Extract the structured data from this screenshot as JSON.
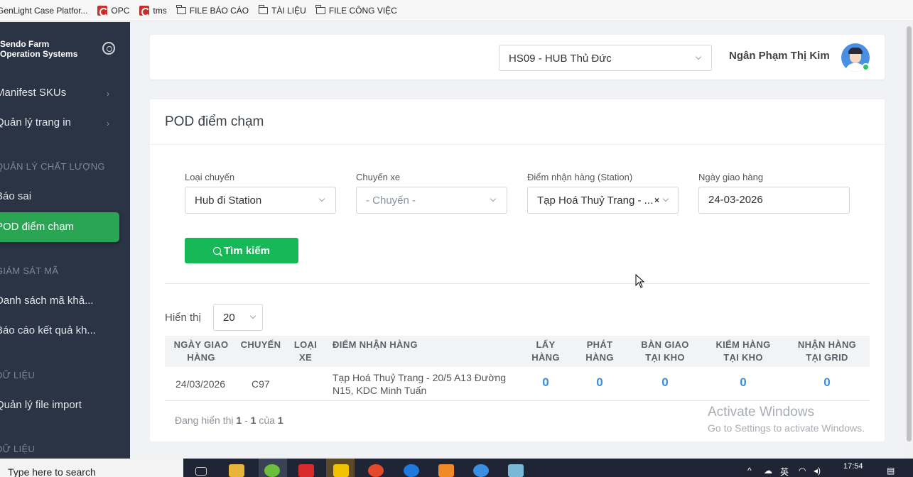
{
  "bookmarks": [
    {
      "label": "GenLight Case Platfor...",
      "icon": "page-icon"
    },
    {
      "label": "OPC",
      "icon": "red-logo-icon"
    },
    {
      "label": "tms",
      "icon": "red-logo-icon"
    },
    {
      "label": "FILE BÁO CÁO",
      "icon": "folder-icon"
    },
    {
      "label": "TÀI LIỆU",
      "icon": "folder-icon"
    },
    {
      "label": "FILE CÔNG VIỆC",
      "icon": "folder-icon"
    }
  ],
  "sidebar": {
    "brand_line1": "Sendo Farm",
    "brand_line2": "Operation Systems",
    "items": {
      "manifest": "Manifest SKUs",
      "print_pages": "Quản lý trang in",
      "section_quality": "QUẢN LÝ CHẤT LƯỢNG",
      "report_wrong": "Báo sai",
      "pod": "POD điểm chạm",
      "section_monitor": "GIÁM SÁT MÃ",
      "code_list": "Danh sách mã khả...",
      "result_report": "Báo cáo kết quả kh...",
      "section_data": "DỮ LIỆU",
      "file_import": "Quản lý file import",
      "section_data2": "DỮ LIỆU"
    }
  },
  "header": {
    "hub_value": "HS09 - HUB Thủ Đức",
    "user_name": "Ngân Phạm Thị Kim"
  },
  "main": {
    "title": "POD điểm chạm",
    "filters": {
      "trip_type_label": "Loại chuyến",
      "trip_type_value": "Hub đi Station",
      "vehicle_label": "Chuyến xe",
      "vehicle_placeholder": "- Chuyến -",
      "station_label": "Điểm nhận hàng (Station)",
      "station_value": "Tạp Hoá Thuỷ Trang - ...",
      "date_label": "Ngày giao hàng",
      "date_value": "24-03-2026"
    },
    "search_label": "Tìm kiếm",
    "show_label": "Hiển thị",
    "page_size": "20",
    "table": {
      "headers": {
        "date": [
          "NGÀY GIAO",
          "HÀNG"
        ],
        "trip": [
          "CHUYẾN"
        ],
        "vehicle_type": [
          "LOẠI",
          "XE"
        ],
        "point": [
          "ĐIỂM NHẬN HÀNG"
        ],
        "pick": [
          "LẤY",
          "HÀNG"
        ],
        "deliver": [
          "PHÁT",
          "HÀNG"
        ],
        "handover": [
          "BÀN GIAO",
          "TẠI KHO"
        ],
        "check": [
          "KIỂM HÀNG",
          "TẠI KHO"
        ],
        "receive": [
          "NHẬN HÀNG",
          "TẠI GRID"
        ]
      },
      "rows": [
        {
          "date": "24/03/2026",
          "trip": "C97",
          "vehicle_type": "",
          "point": "Tạp Hoá Thuỷ Trang - 20/5 A13 Đường N15, KDC Minh Tuấn",
          "pick": "0",
          "deliver": "0",
          "handover": "0",
          "check": "0",
          "receive": "0"
        }
      ]
    },
    "footer": {
      "prefix": "Đang hiển thị",
      "from": "1",
      "dash": "-",
      "to": "1",
      "of": "của",
      "total": "1"
    }
  },
  "watermark": {
    "line1": "Activate Windows",
    "line2": "Go to Settings to activate Windows."
  },
  "taskbar": {
    "search_placeholder": "Type here to search",
    "time": "17:54"
  }
}
